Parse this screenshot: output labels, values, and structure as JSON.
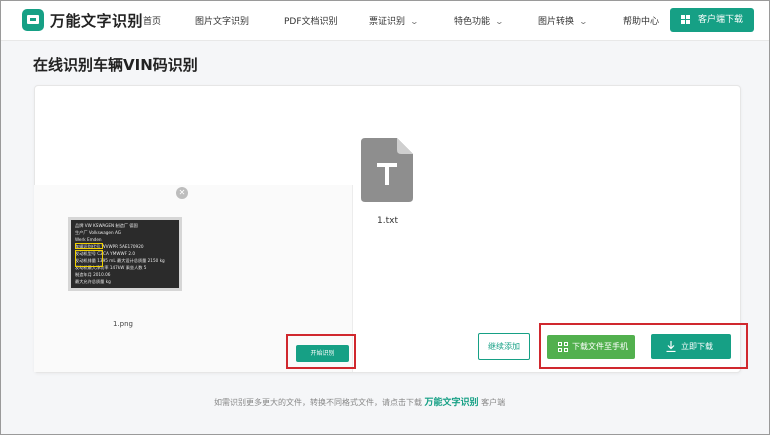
{
  "header": {
    "brand": "万能文字识别",
    "nav": [
      {
        "label": "首页",
        "has_dropdown": false
      },
      {
        "label": "图片文字识别",
        "has_dropdown": false
      },
      {
        "label": "PDF文档识别",
        "has_dropdown": false
      },
      {
        "label": "票证识别",
        "has_dropdown": true
      },
      {
        "label": "特色功能",
        "has_dropdown": true
      },
      {
        "label": "图片转换",
        "has_dropdown": true
      },
      {
        "label": "帮助中心",
        "has_dropdown": false
      }
    ],
    "client_download_label": "客户端下载"
  },
  "page_title": "在线识别车辆VIN码识别",
  "upload": {
    "file_name": "1.png",
    "remove_icon": "close-icon",
    "start_label": "开始识别",
    "plate_lines": [
      "品牌  VW   KSWAGEN 制造厂  德国",
      "生产厂  Volkswagen AG",
      "          Werk Emden",
      "车辆识别代号  WVWPR       5AE170920",
      "发动机型号  CZCA       YMWWF 2.0",
      "发动机排量  1395 mL   最大设计总质量  2150 kg",
      "发动机最大净功率  147kW      乘坐人数  5",
      "制造年月  2010.06",
      "最大允许总质量               kg"
    ]
  },
  "result": {
    "file_name": "1.txt",
    "file_icon": "txt-file-icon",
    "file_icon_letter": "T"
  },
  "actions": {
    "continue_label": "继续添加",
    "download_phone_label": "下载文件至手机",
    "download_now_label": "立即下载"
  },
  "footer": {
    "text_before": "如需识别更多更大的文件，转换不同格式文件，请点击下载",
    "brand": "万能文字识别",
    "text_after": "客户端"
  },
  "colors": {
    "accent": "#16a085",
    "green_button": "#52b04e",
    "highlight_box": "#d0282e"
  }
}
